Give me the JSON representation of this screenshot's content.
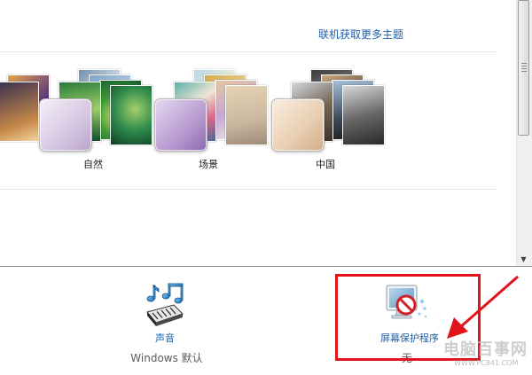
{
  "theme_panel": {
    "get_more_link": "联机获取更多主题",
    "themes": [
      {
        "name": "自然"
      },
      {
        "name": "场景"
      },
      {
        "name": "中国"
      }
    ]
  },
  "bottom_settings": {
    "sound": {
      "label": "声音",
      "value": "Windows 默认"
    },
    "screensaver": {
      "label": "屏幕保护程序",
      "value": "无"
    }
  },
  "watermark": {
    "text": "电脑百事网",
    "url": "WWW.PC841.COM"
  },
  "colors": {
    "link_blue": "#1f5fa8",
    "highlight_red": "#e0141a",
    "separator": "#e4e4e4"
  },
  "icons": {
    "sound": "sound-music-notes-icon",
    "screensaver": "screensaver-monitor-icon",
    "scroll_down": "scroll-down-arrow-icon"
  }
}
